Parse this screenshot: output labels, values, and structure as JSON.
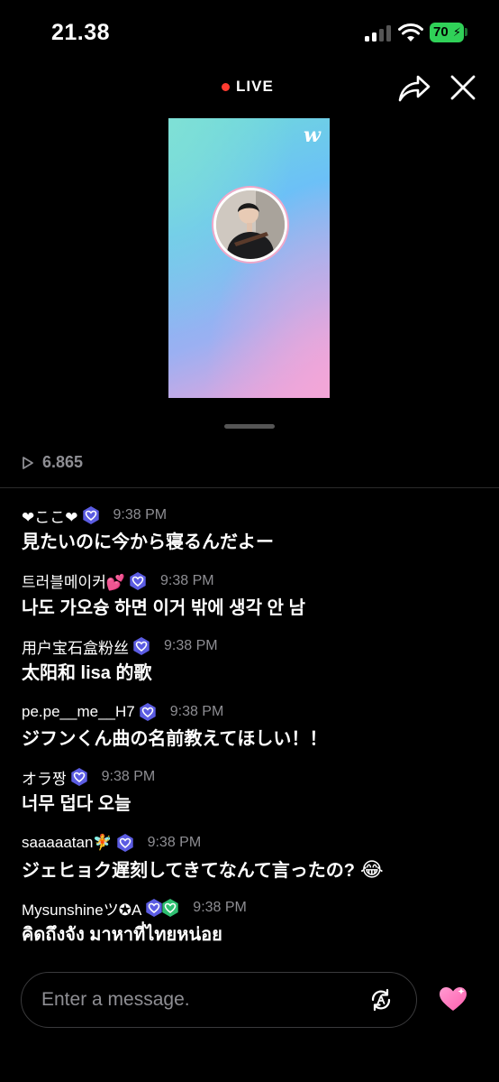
{
  "status_bar": {
    "time": "21.38",
    "battery": "70"
  },
  "header": {
    "live_label": "LIVE",
    "brand_logo": "w"
  },
  "stream": {
    "views": "6.865"
  },
  "chat": [
    {
      "username": "❤ここ❤",
      "badges": 1,
      "time": "9:38 PM",
      "text": "見たいのに今から寝るんだよー"
    },
    {
      "username": "트러블메이커💕",
      "badges": 1,
      "time": "9:38 PM",
      "text": "나도 가오슝 하면 이거 밖에 생각 안 남"
    },
    {
      "username": "用户宝石盒粉丝",
      "badges": 1,
      "time": "9:38 PM",
      "text": "太阳和 lisa 的歌"
    },
    {
      "username": "pe.pe__me__H7",
      "badges": 1,
      "time": "9:38 PM",
      "text": "ジフンくん曲の名前教えてほしい！！"
    },
    {
      "username": "オラ짱",
      "badges": 1,
      "time": "9:38 PM",
      "text": "너무 덥다 오늘"
    },
    {
      "username": "saaaaatan🧚",
      "badges": 1,
      "time": "9:38 PM",
      "text": "ジェヒョク遅刻してきてなんて言ったの?",
      "emoji": "😂"
    },
    {
      "username": "Mysunshineツ✪A",
      "badges": 2,
      "time": "9:38 PM",
      "text": "คิดถึงจัง มาหาที่ไทยหน่อย"
    }
  ],
  "composer": {
    "placeholder": "Enter a message."
  },
  "colors": {
    "live_dot": "#ff3b30",
    "battery": "#30d158",
    "badge": "#5b5ce2",
    "badge_alt": "#2fbf71",
    "heart": "#ff6fb5"
  }
}
